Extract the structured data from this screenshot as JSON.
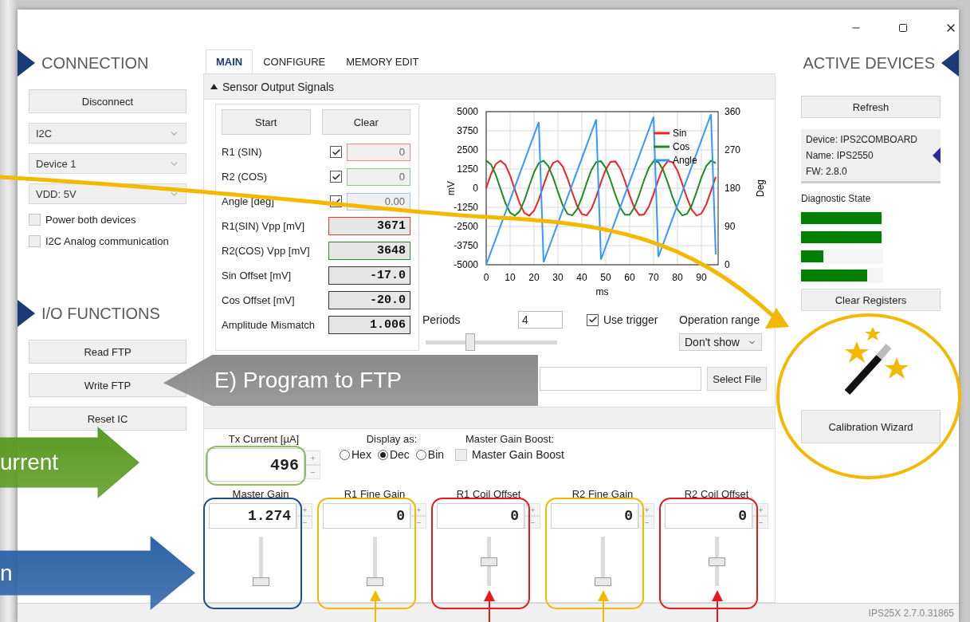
{
  "left": {
    "sections": [
      {
        "title": "CONNECTION",
        "items": [
          {
            "kind": "button",
            "label": "Disconnect"
          },
          {
            "kind": "select",
            "value": "I2C"
          },
          {
            "kind": "select",
            "value": "Device 1"
          },
          {
            "kind": "select",
            "value": "VDD: 5V"
          },
          {
            "kind": "check",
            "label": "Power both devices",
            "checked": false
          },
          {
            "kind": "check",
            "label": "I2C Analog communication",
            "checked": false
          }
        ]
      },
      {
        "title": "I/O FUNCTIONS",
        "items": [
          {
            "kind": "button",
            "label": "Read FTP"
          },
          {
            "kind": "button",
            "label": "Write FTP"
          },
          {
            "kind": "button",
            "label": "Reset IC"
          }
        ]
      }
    ]
  },
  "tabs": [
    {
      "label": "MAIN",
      "selected": true
    },
    {
      "label": "CONFIGURE",
      "selected": false
    },
    {
      "label": "MEMORY EDIT",
      "selected": false
    }
  ],
  "sensor_panel": {
    "title": "Sensor Output Signals",
    "expanded": true,
    "buttons": [
      "Start",
      "Clear"
    ],
    "rows": [
      {
        "kind": "check",
        "label": "R1 (SIN)",
        "checked": true,
        "value": "0",
        "color": "#f08c8c"
      },
      {
        "kind": "check",
        "label": "R2 (COS)",
        "checked": true,
        "value": "0",
        "color": "#8cc98c"
      },
      {
        "kind": "check",
        "label": "Angle [deg]",
        "checked": true,
        "value": "0.00",
        "color": "#9cc7ef"
      },
      {
        "kind": "readout",
        "label": "R1(SIN) Vpp [mV]",
        "value": "3671",
        "color": "#e53935"
      },
      {
        "kind": "readout",
        "label": "R2(COS) Vpp [mV]",
        "value": "3648",
        "color": "#2e8b2e"
      },
      {
        "kind": "readout",
        "label": "Sin Offset [mV]",
        "value": "-17.0",
        "color": "#333333"
      },
      {
        "kind": "readout",
        "label": "Cos Offset [mV]",
        "value": "-20.0",
        "color": "#333333"
      },
      {
        "kind": "readout",
        "label": "Amplitude Mismatch",
        "value": "1.006",
        "color": "#333333"
      }
    ],
    "chart_data": {
      "type": "line",
      "grid": true,
      "legend": true,
      "xlabel": "ms",
      "ylabel": "mV",
      "y2label": "Deg",
      "xlim": [
        0,
        97
      ],
      "ylim": [
        -5000,
        5000
      ],
      "xticks": [
        0,
        10,
        20,
        30,
        40,
        50,
        60,
        70,
        80,
        90
      ],
      "yticks": [
        -5000,
        -3750,
        -2500,
        -1250,
        0,
        1250,
        2500,
        3750,
        5000
      ],
      "y2lim": [
        0,
        360
      ],
      "y2ticks": [
        0,
        90,
        180,
        270,
        360
      ],
      "x": [
        0,
        2,
        4,
        6,
        8,
        10,
        12,
        14,
        16,
        18,
        20,
        22,
        24,
        26,
        28,
        30,
        32,
        34,
        36,
        38,
        40,
        42,
        44,
        46,
        48,
        50,
        52,
        54,
        56,
        58,
        60,
        62,
        64,
        66,
        68,
        70,
        72,
        74,
        76,
        78,
        80,
        82,
        84,
        86,
        88,
        90,
        92,
        94,
        96
      ],
      "series": [
        {
          "name": "Sin",
          "color": "#ee2222",
          "values": [
            0,
            913,
            1574,
            1799,
            1526,
            831,
            -97,
            -996,
            -1620,
            -1794,
            -1473,
            -743,
            191,
            1073,
            1658,
            1784,
            1417,
            653,
            -284,
            -1150,
            -1694,
            -1769,
            -1354,
            -565,
            380,
            1220,
            1723,
            1749,
            1290,
            475,
            -475,
            -1290,
            -1749,
            -1723,
            -1220,
            -380,
            565,
            1354,
            1769,
            1694,
            1150,
            284,
            -653,
            -1417,
            -1784,
            -1658,
            -1073,
            -191,
            743
          ]
        },
        {
          "name": "Cos",
          "color": "#1e8c1e",
          "values": [
            1800,
            1551,
            873,
            -47,
            -954,
            -1597,
            -1797,
            -1499,
            -786,
            144,
            1035,
            1640,
            1790,
            1445,
            700,
            -238,
            -1111,
            -1677,
            -1777,
            -1385,
            -610,
            335,
            1186,
            1709,
            1759,
            1323,
            520,
            -426,
            -1255,
            -1736,
            -1736,
            -1255,
            -426,
            520,
            1323,
            1759,
            1709,
            1186,
            335,
            -610,
            -1385,
            -1777,
            -1677,
            -1111,
            -238,
            700,
            1445,
            1790,
            1640
          ]
        },
        {
          "name": "Angle",
          "color": "#3399ff",
          "axis": "y2",
          "values": [
            0,
            30.5,
            61,
            91.5,
            122,
            152.5,
            183.1,
            213.6,
            244.1,
            274.6,
            305.1,
            335.6,
            6.1,
            36.6,
            67.1,
            97.6,
            128.1,
            158.7,
            189.1,
            219.7,
            250.2,
            280.7,
            311.2,
            341.7,
            12.2,
            42.7,
            73.2,
            103.7,
            134.2,
            164.7,
            195.3,
            225.8,
            256.3,
            286.8,
            317.3,
            347.8,
            18.3,
            48.8,
            79.3,
            109.8,
            140.3,
            170.9,
            201.3,
            231.9,
            262.4,
            292.9,
            323.4,
            353.9,
            24.4
          ]
        }
      ]
    },
    "periods": {
      "label": "Periods",
      "value": "4",
      "level": 0.34
    },
    "use_trigger": {
      "label": "Use trigger",
      "checked": true
    },
    "operation_range": {
      "label": "Operation range",
      "value": "Don't show"
    },
    "file": {
      "button": "Select File"
    }
  },
  "settings": {
    "tx_current": {
      "label": "Tx Current [µA]",
      "value": "496",
      "color": "#8dc05c"
    },
    "display_as": {
      "label": "Display as:",
      "options": [
        {
          "label": "Hex",
          "selected": false
        },
        {
          "label": "Dec",
          "selected": true
        },
        {
          "label": "Bin",
          "selected": false
        }
      ]
    },
    "master_gain_boost": {
      "label": "Master Gain Boost:",
      "checkbox_label": "Master Gain Boost",
      "checked": false
    },
    "gains": [
      {
        "label": "Master Gain",
        "value": "1.274",
        "level": 0,
        "color": "#1f4e8c",
        "pointer": false
      },
      {
        "label": "R1 Fine Gain",
        "value": "0",
        "level": 0,
        "color": "#f5b800",
        "pointer": true
      },
      {
        "label": "R1 Coil Offset",
        "value": "0",
        "level": 0.5,
        "color": "#e31b1b",
        "pointer": true
      },
      {
        "label": "R2 Fine Gain",
        "value": "0",
        "level": 0,
        "color": "#f5b800",
        "pointer": true
      },
      {
        "label": "R2 Coil Offset",
        "value": "0",
        "level": 0.5,
        "color": "#e31b1b",
        "pointer": true
      }
    ]
  },
  "devices": {
    "title": "ACTIVE DEVICES",
    "refresh": "Refresh",
    "device_lines": [
      "Device: IPS2COMBOARD",
      "Name: IPS2550",
      "FW: 2.8.0"
    ],
    "diagnostic": {
      "label": "Diagnostic State",
      "bars": [
        {
          "level": 1
        },
        {
          "level": 1
        },
        {
          "level": 0.273
        },
        {
          "level": 0.818
        }
      ]
    },
    "clear": "Clear Registers",
    "wizard": "Calibration Wizard"
  },
  "status_bar": {
    "version": "IPS25X 2.7.0.31865"
  },
  "annotations": {
    "callouts": [
      {
        "text": "E) Program to FTP",
        "color": "#8a8a8a"
      },
      {
        "text": "urrent",
        "color": "#5c9a23"
      },
      {
        "text": "n",
        "color": "#2f64a8"
      }
    ]
  }
}
